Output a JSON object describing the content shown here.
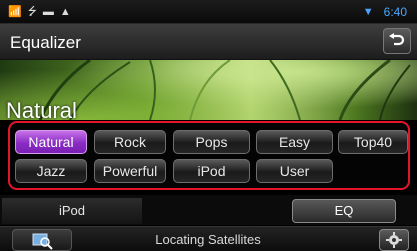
{
  "status_bar": {
    "left_icons": [
      "signal-icon",
      "usb-icon",
      "battery-icon",
      "warning-icon"
    ],
    "wifi_icon": "wifi-icon",
    "time": "6:40"
  },
  "header": {
    "title": "Equalizer",
    "back_icon": "back-arrow-icon"
  },
  "banner": {
    "preset_label": "Natural"
  },
  "presets": {
    "items": [
      {
        "label": "Natural",
        "selected": true
      },
      {
        "label": "Rock",
        "selected": false
      },
      {
        "label": "Pops",
        "selected": false
      },
      {
        "label": "Easy",
        "selected": false
      },
      {
        "label": "Top40",
        "selected": false
      },
      {
        "label": "Jazz",
        "selected": false
      },
      {
        "label": "Powerful",
        "selected": false
      },
      {
        "label": "iPod",
        "selected": false
      },
      {
        "label": "User",
        "selected": false
      }
    ],
    "highlight_color": "#e3152c",
    "selected_color": "#8a2cc3"
  },
  "tabs": {
    "source_label": "iPod",
    "eq_label": "EQ"
  },
  "footer": {
    "nav_icon": "map-search-icon",
    "status": "Locating Satellites",
    "setup_icon": "gear-icon"
  }
}
